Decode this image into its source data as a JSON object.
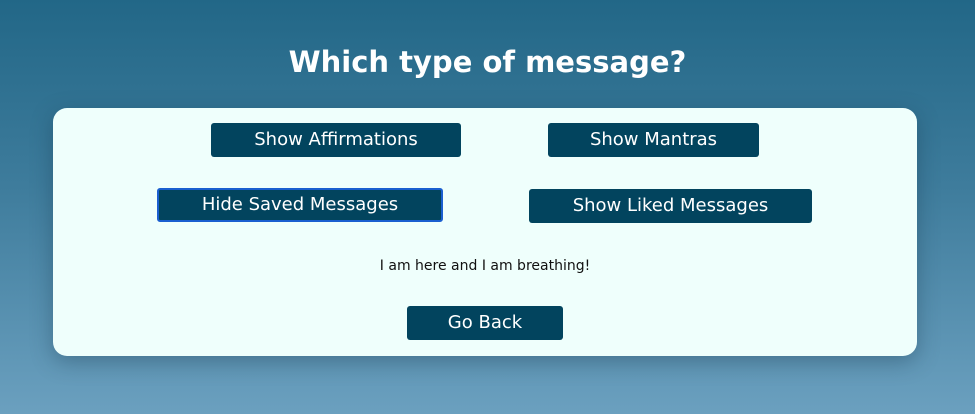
{
  "page": {
    "title": "Which type of message?"
  },
  "buttons": {
    "show_affirmations": "Show Affirmations",
    "show_mantras": "Show Mantras",
    "hide_saved": "Hide Saved Messages",
    "show_liked": "Show Liked Messages",
    "go_back": "Go Back"
  },
  "message": {
    "text": "I am here and I am breathing!"
  },
  "colors": {
    "button_bg": "#02445e",
    "panel_bg": "#effffc",
    "focus_ring": "#1a5fd0"
  }
}
